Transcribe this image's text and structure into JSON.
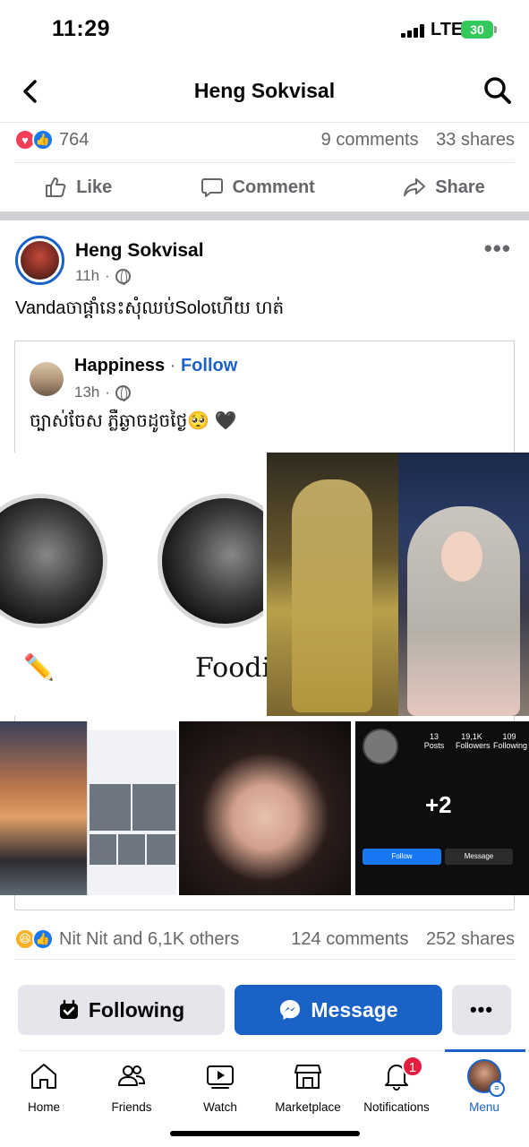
{
  "status_bar": {
    "time": "11:29",
    "network": "LTE",
    "battery": "30"
  },
  "header": {
    "title": "Heng Sokvisal",
    "back_icon": "chevron-left-icon",
    "search_icon": "search-icon"
  },
  "post1": {
    "reactions_count": "764",
    "comments": "9 comments",
    "shares": "33 shares",
    "actions": {
      "like": "Like",
      "comment": "Comment",
      "share": "Share"
    }
  },
  "post2": {
    "author": "Heng Sokvisal",
    "time": "11h",
    "text": "Vandaចាផ្ដាំនេះសុំឈប់Soloហើយ ហត់",
    "shared": {
      "author": "Happiness",
      "separator": "·",
      "follow": "Follow",
      "time": "13h",
      "text": "ច្បាស់ចែស ភ្លឺឆ្ងាចដូចថ្ងៃ🥺 🖤"
    },
    "images": {
      "food_label": "Foodie",
      "ig_posts": "13",
      "ig_posts_label": "Posts",
      "ig_followers": "19,1K",
      "ig_followers_label": "Followers",
      "ig_following": "109",
      "ig_following_label": "Following",
      "ig_plus": "+2",
      "ig_follow": "Follow",
      "ig_message": "Message"
    },
    "reactions_text": "Nit Nit and 6,1K others",
    "comments": "124 comments",
    "shares": "252 shares"
  },
  "profile_buttons": {
    "following": "Following",
    "message": "Message",
    "more": "•••"
  },
  "bottom_nav": [
    {
      "label": "Home",
      "icon": "home-icon"
    },
    {
      "label": "Friends",
      "icon": "friends-icon"
    },
    {
      "label": "Watch",
      "icon": "watch-icon"
    },
    {
      "label": "Marketplace",
      "icon": "marketplace-icon"
    },
    {
      "label": "Notifications",
      "icon": "bell-icon",
      "badge": "1"
    },
    {
      "label": "Menu",
      "icon": "menu-avatar-icon"
    }
  ],
  "colors": {
    "brand": "#1b62c7",
    "muted": "#65676b",
    "badge": "#e41e3f"
  }
}
